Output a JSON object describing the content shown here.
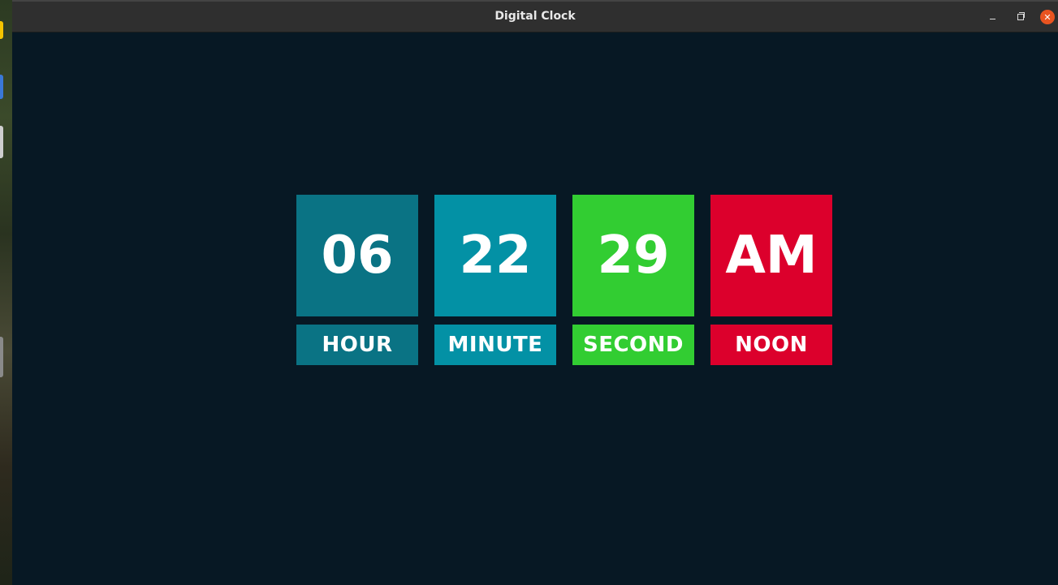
{
  "window": {
    "title": "Digital Clock",
    "close_icon": "close-icon",
    "minimize_icon": "minimize-icon",
    "maximize_icon": "restore-icon"
  },
  "clock": {
    "hour": {
      "value": "06",
      "label": "HOUR",
      "color": "#0a7384"
    },
    "minute": {
      "value": "22",
      "label": "MINUTE",
      "color": "#0391a5"
    },
    "second": {
      "value": "29",
      "label": "SECOND",
      "color": "#32cd32"
    },
    "period": {
      "value": "AM",
      "label": "NOON",
      "color": "#dc002c"
    }
  },
  "colors": {
    "background": "#071824",
    "titlebar": "#2f2f2f",
    "close_button": "#e95420"
  }
}
